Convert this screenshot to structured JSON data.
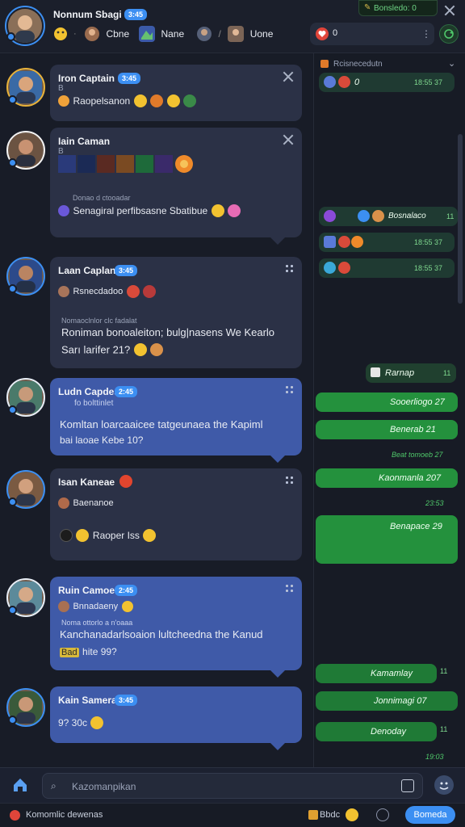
{
  "header": {
    "user_name": "Nonnum Sbagi",
    "user_badge": "3:45",
    "chips": [
      {
        "label": "Cbne"
      },
      {
        "label": "Nane"
      },
      {
        "label": "Uone"
      }
    ],
    "count": "0",
    "status_label": "Bonsledo: 0"
  },
  "messages": [
    {
      "name": "Iron Captain",
      "badge": "3:45",
      "sub": "B",
      "text": "Raopelsanon"
    },
    {
      "name": "Iain Caman",
      "badge": "",
      "sub": "B",
      "line_small": "Donao d ctooadar",
      "text": "Senagiral perfibsasne Sbatibue"
    },
    {
      "name": "Laan Caplan",
      "badge": "3:45",
      "sub": "Rsnecdadoo",
      "line_small": "Nomaoclnlor clc fadalat",
      "text": "Roniman bonoaleiton; bulg|nasens We Kearlo",
      "text2": "Sarı larifer 21?"
    },
    {
      "name": "Ludn Capdes",
      "badge": "2:45",
      "sub": "fo bolttinlet",
      "text": "Komltan loarcaaicee tatgeunaea the Kapiml",
      "text2": "bai laoae Kebe 10?"
    },
    {
      "name": "Isan Kaneae",
      "badge": "",
      "sub": "Baenanoe",
      "text": "Raoper Iss"
    },
    {
      "name": "Ruin Camoe",
      "badge": "2:45",
      "sub": "Bnnadaeny",
      "line_small": "Noma ottorlo a n'oaaa",
      "text": "Kanchanadarlsoaion lultcheedna the Kanud",
      "text2": "hite 99?",
      "text2_prefix": "Bad"
    },
    {
      "name": "Kain Samera",
      "badge": "3:45",
      "sub": "",
      "text": "9? 30c"
    }
  ],
  "panel": {
    "title": "Rcisnecedutn",
    "items": [
      {
        "text": "0",
        "time": "18:55 37"
      },
      {
        "text": "Bosnalaco",
        "time": "11"
      },
      {
        "text": "",
        "time": "18:55 37"
      },
      {
        "text": "",
        "time": "18:55 37"
      },
      {
        "text": "Rarnap",
        "time": "11"
      },
      {
        "text": "Sooerliogo 27",
        "time": ""
      },
      {
        "text": "Benerab 21",
        "time": ""
      },
      {
        "text": "",
        "time": "Beat tomoeb 27"
      },
      {
        "text": "Kaonmanla 207",
        "time": ""
      },
      {
        "text": "",
        "time": "23:53"
      },
      {
        "text": "Benapace 29",
        "time": ""
      },
      {
        "text": "Kamamlay",
        "time": "11"
      },
      {
        "text": "Jonnimagi 07",
        "time": ""
      },
      {
        "text": "Denoday",
        "time": "11"
      },
      {
        "text": "",
        "time": "19:03"
      }
    ]
  },
  "composer": {
    "placeholder": "Kazomanpikan"
  },
  "status": {
    "left": "Komomlic dewenas",
    "right_label": "Bbdc",
    "button": "Bomeda"
  },
  "colors": {
    "accent": "#3c8ff2",
    "green": "#24913d",
    "bg": "#181c27"
  }
}
